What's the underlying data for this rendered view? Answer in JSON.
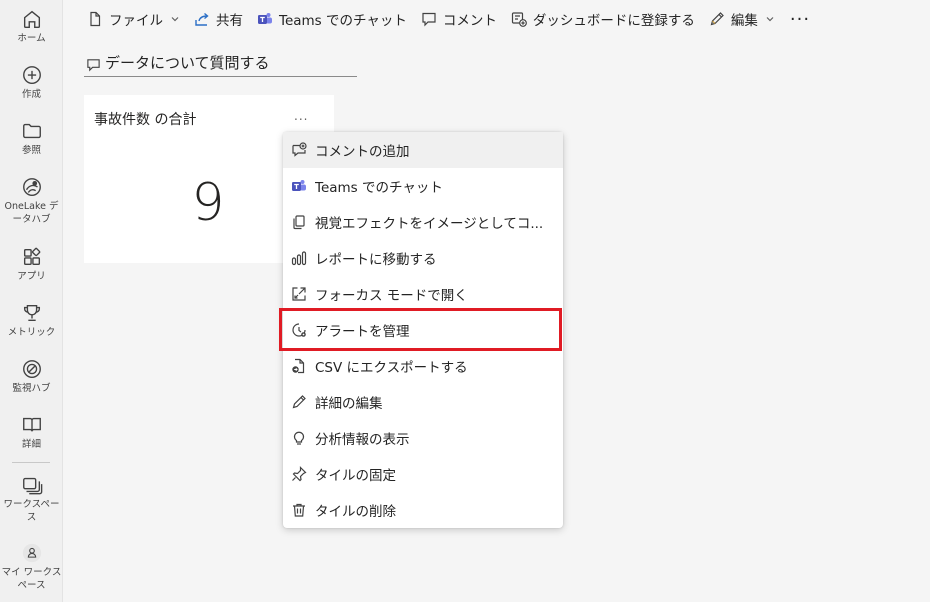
{
  "rail": {
    "items": [
      {
        "label": "ホーム",
        "icon": "home-icon"
      },
      {
        "label": "作成",
        "icon": "plus-circle-icon"
      },
      {
        "label": "参照",
        "icon": "folder-icon"
      },
      {
        "label": "OneLake データハブ",
        "icon": "onelake-icon"
      },
      {
        "label": "アプリ",
        "icon": "apps-icon"
      },
      {
        "label": "メトリック",
        "icon": "trophy-icon"
      },
      {
        "label": "監視ハブ",
        "icon": "monitor-hub-icon"
      },
      {
        "label": "詳細",
        "icon": "book-icon"
      },
      {
        "label": "ワークスペース",
        "icon": "workspaces-icon"
      },
      {
        "label": "マイ ワークスペース",
        "icon": "my-workspace-icon"
      }
    ]
  },
  "toolbar": {
    "file": "ファイル",
    "share": "共有",
    "teams_chat": "Teams でのチャット",
    "comment": "コメント",
    "pin_dashboard": "ダッシュボードに登録する",
    "edit": "編集",
    "more": "···"
  },
  "qa": {
    "placeholder": "データについて質問する"
  },
  "tile": {
    "title": "事故件数 の合計",
    "more": "...",
    "value": "9"
  },
  "menu": {
    "items": [
      {
        "label": "コメントの追加",
        "icon": "comment-add-icon"
      },
      {
        "label": "Teams でのチャット",
        "icon": "teams-icon"
      },
      {
        "label": "視覚エフェクトをイメージとしてコ...",
        "icon": "copy-icon"
      },
      {
        "label": "レポートに移動する",
        "icon": "bar-chart-icon"
      },
      {
        "label": "フォーカス モードで開く",
        "icon": "focus-mode-icon"
      },
      {
        "label": "アラートを管理",
        "icon": "alert-icon"
      },
      {
        "label": "CSV にエクスポートする",
        "icon": "export-icon"
      },
      {
        "label": "詳細の編集",
        "icon": "pencil-icon"
      },
      {
        "label": "分析情報の表示",
        "icon": "lightbulb-icon"
      },
      {
        "label": "タイルの固定",
        "icon": "pin-icon"
      },
      {
        "label": "タイルの削除",
        "icon": "trash-icon"
      }
    ]
  },
  "colors": {
    "highlight": "#e01b24",
    "teams_purple": "#5b5fc7",
    "share_blue": "#2b6fc6"
  }
}
